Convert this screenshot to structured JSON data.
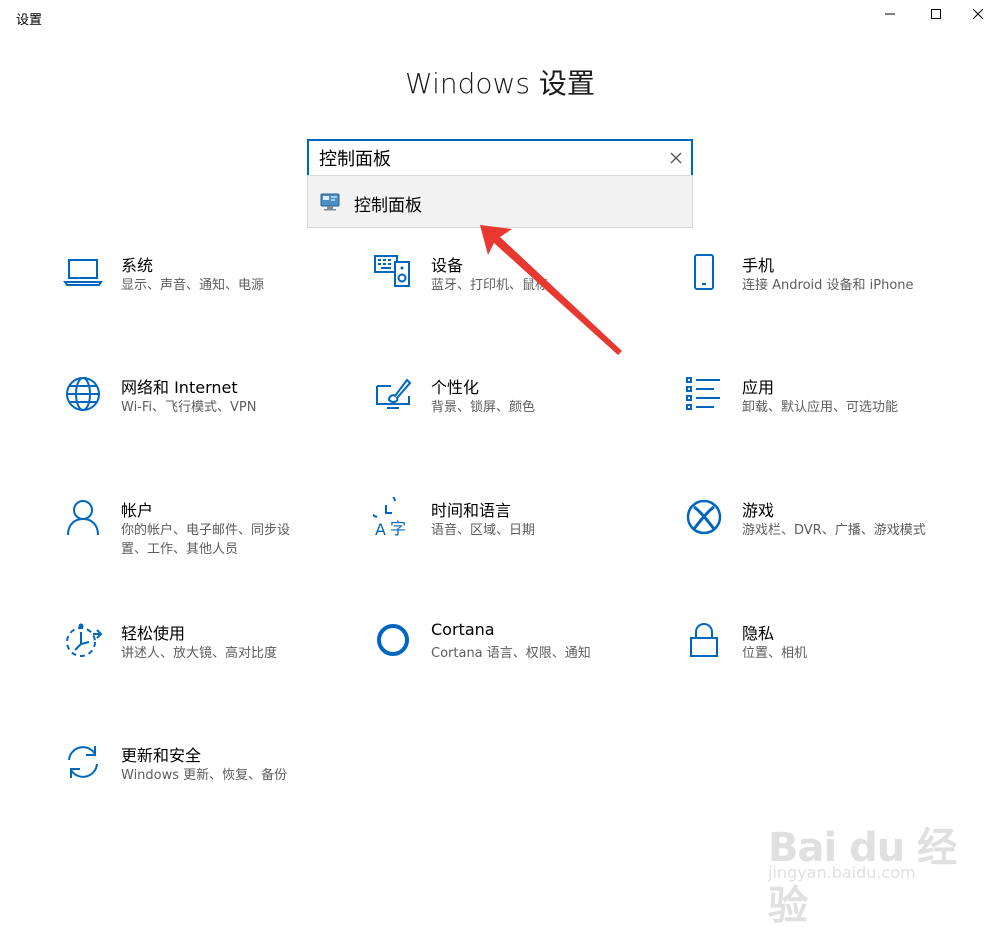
{
  "window": {
    "title": "设置",
    "controls": [
      "minimize",
      "maximize",
      "close"
    ]
  },
  "header": {
    "title": "Windows 设置"
  },
  "search": {
    "value": "控制面板",
    "suggestion": "控制面板"
  },
  "tiles": [
    {
      "title": "系统",
      "desc": "显示、声音、通知、电源",
      "icon": "laptop-icon"
    },
    {
      "title": "设备",
      "desc": "蓝牙、打印机、鼠标",
      "icon": "devices-icon"
    },
    {
      "title": "手机",
      "desc": "连接 Android 设备和 iPhone",
      "icon": "phone-icon"
    },
    {
      "title": "网络和 Internet",
      "desc": "Wi-Fi、飞行模式、VPN",
      "icon": "globe-icon"
    },
    {
      "title": "个性化",
      "desc": "背景、锁屏、颜色",
      "icon": "personalization-icon"
    },
    {
      "title": "应用",
      "desc": "卸载、默认应用、可选功能",
      "icon": "apps-list-icon"
    },
    {
      "title": "帐户",
      "desc": "你的帐户、电子邮件、同步设置、工作、其他人员",
      "icon": "person-icon"
    },
    {
      "title": "时间和语言",
      "desc": "语音、区域、日期",
      "icon": "time-language-icon"
    },
    {
      "title": "游戏",
      "desc": "游戏栏、DVR、广播、游戏模式",
      "icon": "xbox-icon"
    },
    {
      "title": "轻松使用",
      "desc": "讲述人、放大镜、高对比度",
      "icon": "ease-of-access-icon"
    },
    {
      "title": "Cortana",
      "desc": "Cortana 语言、权限、通知",
      "icon": "cortana-icon"
    },
    {
      "title": "隐私",
      "desc": "位置、相机",
      "icon": "lock-icon"
    },
    {
      "title": "更新和安全",
      "desc": "Windows 更新、恢复、备份",
      "icon": "update-icon"
    }
  ],
  "watermark": {
    "brand": "Bai du 经验",
    "url": "jingyan.baidu.com"
  },
  "colors": {
    "accent": "#0067c0",
    "arrow": "#e8382f",
    "desc_text": "#5d5d5d"
  }
}
